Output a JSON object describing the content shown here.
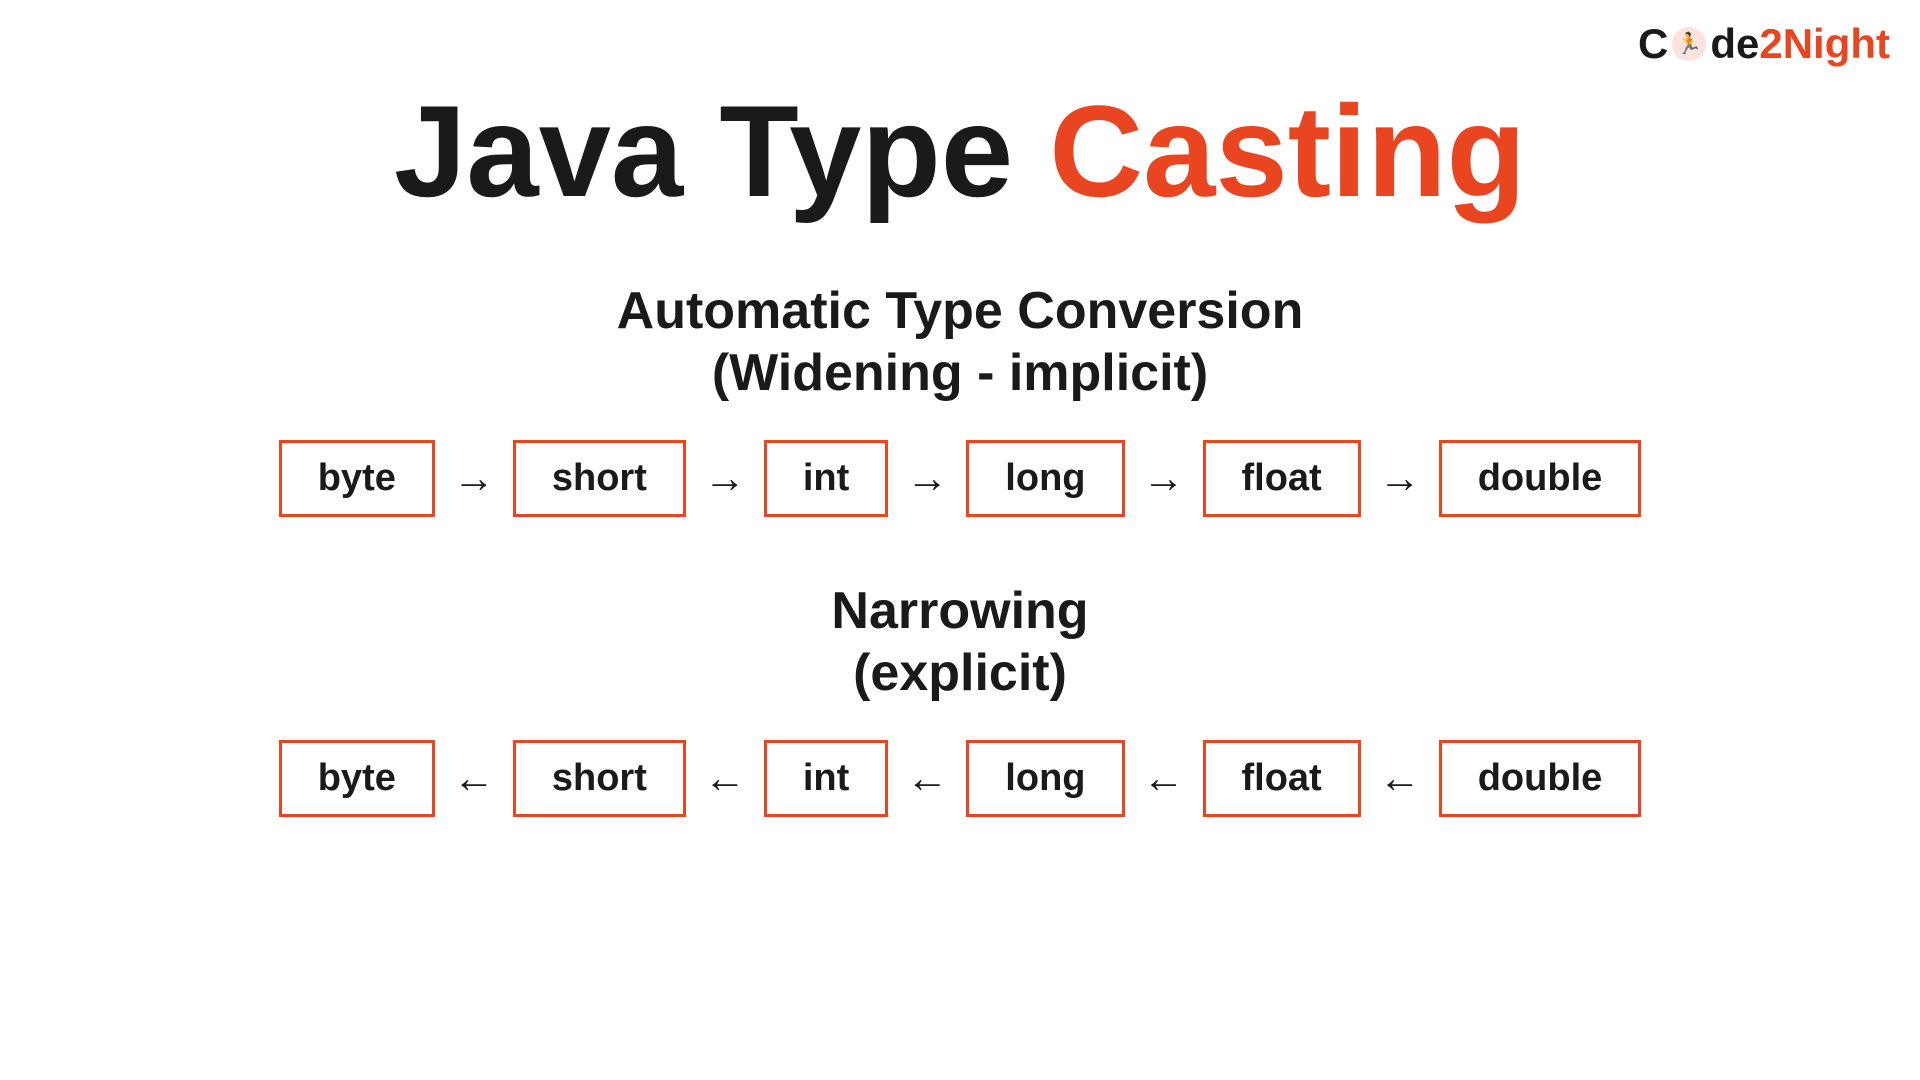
{
  "logo": {
    "part1": "C",
    "part2": "de",
    "part3": "2Night"
  },
  "title": {
    "part1": "Java Type ",
    "part2": "Casting"
  },
  "widening": {
    "heading_line1": "Automatic Type Conversion",
    "heading_line2": "(Widening - implicit)",
    "types": [
      "byte",
      "short",
      "int",
      "long",
      "float",
      "double"
    ],
    "arrow": "→"
  },
  "narrowing": {
    "heading_line1": "Narrowing",
    "heading_line2": "(explicit)",
    "types": [
      "byte",
      "short",
      "int",
      "long",
      "float",
      "double"
    ],
    "arrow": "←"
  }
}
